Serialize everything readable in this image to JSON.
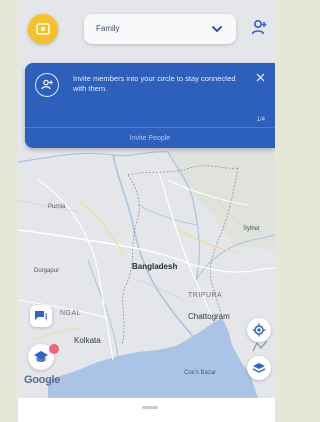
{
  "header": {
    "circle_name": "Family"
  },
  "invite_banner": {
    "message": "Invite members into your circle to stay connected with them.",
    "pager": "1/4",
    "action_label": "Invite People"
  },
  "map": {
    "labels": {
      "bangladesh": "Bangladesh",
      "chattogram": "Chattogram",
      "kolkata": "Kolkata",
      "tripura": "TRIPURA",
      "bengal": "NGAL",
      "sylhet": "Sylhet",
      "purnia": "Purnia",
      "durgapur": "Durgapur",
      "bay": "Cox's Bazar"
    },
    "attribution": "Google"
  },
  "colors": {
    "accent_yellow": "#f6c126",
    "banner_blue": "#2d5fbd",
    "icon_blue": "#2f63c6",
    "notification": "#f2647a"
  },
  "icons": {
    "logo": "location-pin-icon",
    "dropdown": "chevron-down-icon",
    "add_member": "add-person-icon",
    "close": "close-icon",
    "chat": "chat-icon",
    "checkin": "checkin-icon",
    "location": "crosshair-icon",
    "layers": "layers-icon"
  }
}
